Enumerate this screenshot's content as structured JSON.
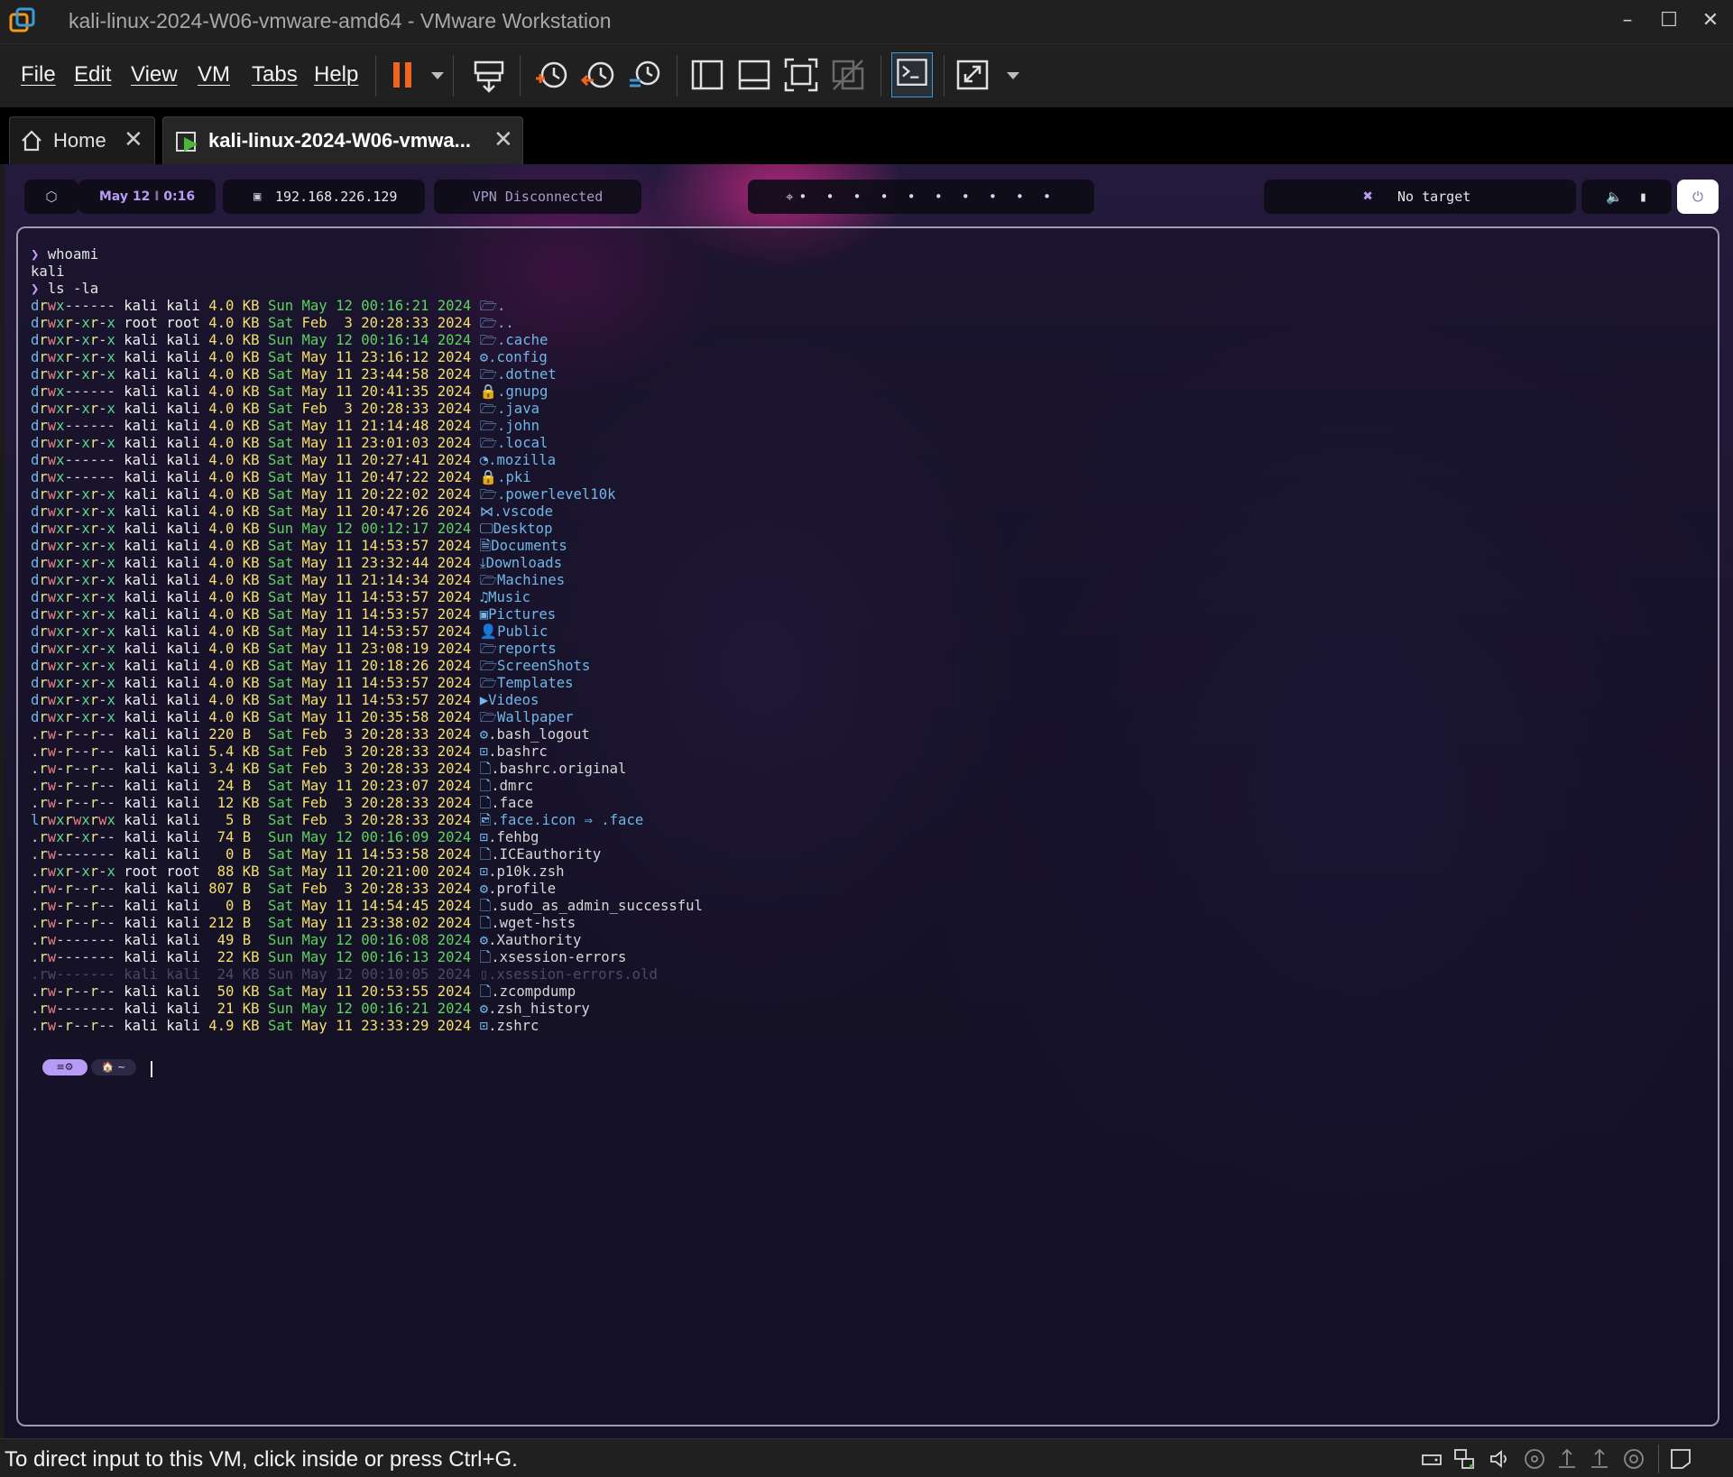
{
  "window": {
    "title": "kali-linux-2024-W06-vmware-amd64 - VMware Workstation"
  },
  "menu": [
    "File",
    "Edit",
    "View",
    "VM",
    "Tabs",
    "Help"
  ],
  "tabs": [
    {
      "label": "Home"
    },
    {
      "label": "kali-linux-2024-W06-vmwa..."
    }
  ],
  "toolbar_icons": [
    "pause-icon",
    "dropdown-icon",
    "send-ctrl-alt-del-icon",
    "take-snapshot-icon",
    "revert-snapshot-icon",
    "snapshot-manager-icon",
    "library-icon",
    "thumbnail-bar-icon",
    "full-screen-icon",
    "unity-icon",
    "console-view-icon",
    "stretch-guest-icon"
  ],
  "panel": {
    "date": "May 12",
    "time": "0:16",
    "ip": "192.168.226.129",
    "vpn": "VPN Disconnected",
    "target": "No target"
  },
  "terminal": {
    "commands": [
      {
        "prompt": "❯",
        "cmd": "whoami"
      },
      {
        "output": "kali"
      },
      {
        "prompt": "❯",
        "cmd": "ls -la"
      }
    ],
    "listing": [
      {
        "perm": "drwx------",
        "user": "kali",
        "group": "kali",
        "size": "4.0",
        "unit": "KB",
        "day": "Sun",
        "month": "May",
        "date": "12",
        "time": "00:16:21",
        "year": "2024",
        "icon": "🗁",
        "name": "."
      },
      {
        "perm": "drwxr-xr-x",
        "user": "root",
        "group": "root",
        "size": "4.0",
        "unit": "KB",
        "day": "Sat",
        "month": "Feb",
        "date": " 3",
        "time": "20:28:33",
        "year": "2024",
        "icon": "🗁",
        "name": ".."
      },
      {
        "perm": "drwxr-xr-x",
        "user": "kali",
        "group": "kali",
        "size": "4.0",
        "unit": "KB",
        "day": "Sun",
        "month": "May",
        "date": "12",
        "time": "00:16:14",
        "year": "2024",
        "icon": "🗁",
        "name": ".cache"
      },
      {
        "perm": "drwxr-xr-x",
        "user": "kali",
        "group": "kali",
        "size": "4.0",
        "unit": "KB",
        "day": "Sat",
        "month": "May",
        "date": "11",
        "time": "23:16:12",
        "year": "2024",
        "icon": "⚙",
        "name": ".config"
      },
      {
        "perm": "drwxr-xr-x",
        "user": "kali",
        "group": "kali",
        "size": "4.0",
        "unit": "KB",
        "day": "Sat",
        "month": "May",
        "date": "11",
        "time": "23:44:58",
        "year": "2024",
        "icon": "🗁",
        "name": ".dotnet"
      },
      {
        "perm": "drwx------",
        "user": "kali",
        "group": "kali",
        "size": "4.0",
        "unit": "KB",
        "day": "Sat",
        "month": "May",
        "date": "11",
        "time": "20:41:35",
        "year": "2024",
        "icon": "🔒",
        "name": ".gnupg"
      },
      {
        "perm": "drwxr-xr-x",
        "user": "kali",
        "group": "kali",
        "size": "4.0",
        "unit": "KB",
        "day": "Sat",
        "month": "Feb",
        "date": " 3",
        "time": "20:28:33",
        "year": "2024",
        "icon": "🗁",
        "name": ".java"
      },
      {
        "perm": "drwx------",
        "user": "kali",
        "group": "kali",
        "size": "4.0",
        "unit": "KB",
        "day": "Sat",
        "month": "May",
        "date": "11",
        "time": "21:14:48",
        "year": "2024",
        "icon": "🗁",
        "name": ".john"
      },
      {
        "perm": "drwxr-xr-x",
        "user": "kali",
        "group": "kali",
        "size": "4.0",
        "unit": "KB",
        "day": "Sat",
        "month": "May",
        "date": "11",
        "time": "23:01:03",
        "year": "2024",
        "icon": "🗁",
        "name": ".local"
      },
      {
        "perm": "drwx------",
        "user": "kali",
        "group": "kali",
        "size": "4.0",
        "unit": "KB",
        "day": "Sat",
        "month": "May",
        "date": "11",
        "time": "20:27:41",
        "year": "2024",
        "icon": "◔",
        "name": ".mozilla"
      },
      {
        "perm": "drwx------",
        "user": "kali",
        "group": "kali",
        "size": "4.0",
        "unit": "KB",
        "day": "Sat",
        "month": "May",
        "date": "11",
        "time": "20:47:22",
        "year": "2024",
        "icon": "🔒",
        "name": ".pki"
      },
      {
        "perm": "drwxr-xr-x",
        "user": "kali",
        "group": "kali",
        "size": "4.0",
        "unit": "KB",
        "day": "Sat",
        "month": "May",
        "date": "11",
        "time": "20:22:02",
        "year": "2024",
        "icon": "🗁",
        "name": ".powerlevel10k"
      },
      {
        "perm": "drwxr-xr-x",
        "user": "kali",
        "group": "kali",
        "size": "4.0",
        "unit": "KB",
        "day": "Sat",
        "month": "May",
        "date": "11",
        "time": "20:47:26",
        "year": "2024",
        "icon": "⋈",
        "name": ".vscode"
      },
      {
        "perm": "drwxr-xr-x",
        "user": "kali",
        "group": "kali",
        "size": "4.0",
        "unit": "KB",
        "day": "Sun",
        "month": "May",
        "date": "12",
        "time": "00:12:17",
        "year": "2024",
        "icon": "🖵",
        "name": "Desktop"
      },
      {
        "perm": "drwxr-xr-x",
        "user": "kali",
        "group": "kali",
        "size": "4.0",
        "unit": "KB",
        "day": "Sat",
        "month": "May",
        "date": "11",
        "time": "14:53:57",
        "year": "2024",
        "icon": "🗎",
        "name": "Documents"
      },
      {
        "perm": "drwxr-xr-x",
        "user": "kali",
        "group": "kali",
        "size": "4.0",
        "unit": "KB",
        "day": "Sat",
        "month": "May",
        "date": "11",
        "time": "23:32:44",
        "year": "2024",
        "icon": "⤓",
        "name": "Downloads"
      },
      {
        "perm": "drwxr-xr-x",
        "user": "kali",
        "group": "kali",
        "size": "4.0",
        "unit": "KB",
        "day": "Sat",
        "month": "May",
        "date": "11",
        "time": "21:14:34",
        "year": "2024",
        "icon": "🗁",
        "name": "Machines"
      },
      {
        "perm": "drwxr-xr-x",
        "user": "kali",
        "group": "kali",
        "size": "4.0",
        "unit": "KB",
        "day": "Sat",
        "month": "May",
        "date": "11",
        "time": "14:53:57",
        "year": "2024",
        "icon": "♫",
        "name": "Music"
      },
      {
        "perm": "drwxr-xr-x",
        "user": "kali",
        "group": "kali",
        "size": "4.0",
        "unit": "KB",
        "day": "Sat",
        "month": "May",
        "date": "11",
        "time": "14:53:57",
        "year": "2024",
        "icon": "▣",
        "name": "Pictures"
      },
      {
        "perm": "drwxr-xr-x",
        "user": "kali",
        "group": "kali",
        "size": "4.0",
        "unit": "KB",
        "day": "Sat",
        "month": "May",
        "date": "11",
        "time": "14:53:57",
        "year": "2024",
        "icon": "👤",
        "name": "Public"
      },
      {
        "perm": "drwxr-xr-x",
        "user": "kali",
        "group": "kali",
        "size": "4.0",
        "unit": "KB",
        "day": "Sat",
        "month": "May",
        "date": "11",
        "time": "23:08:19",
        "year": "2024",
        "icon": "🗁",
        "name": "reports"
      },
      {
        "perm": "drwxr-xr-x",
        "user": "kali",
        "group": "kali",
        "size": "4.0",
        "unit": "KB",
        "day": "Sat",
        "month": "May",
        "date": "11",
        "time": "20:18:26",
        "year": "2024",
        "icon": "🗁",
        "name": "ScreenShots"
      },
      {
        "perm": "drwxr-xr-x",
        "user": "kali",
        "group": "kali",
        "size": "4.0",
        "unit": "KB",
        "day": "Sat",
        "month": "May",
        "date": "11",
        "time": "14:53:57",
        "year": "2024",
        "icon": "🗁",
        "name": "Templates"
      },
      {
        "perm": "drwxr-xr-x",
        "user": "kali",
        "group": "kali",
        "size": "4.0",
        "unit": "KB",
        "day": "Sat",
        "month": "May",
        "date": "11",
        "time": "14:53:57",
        "year": "2024",
        "icon": "▶",
        "name": "Videos"
      },
      {
        "perm": "drwxr-xr-x",
        "user": "kali",
        "group": "kali",
        "size": "4.0",
        "unit": "KB",
        "day": "Sat",
        "month": "May",
        "date": "11",
        "time": "20:35:58",
        "year": "2024",
        "icon": "🗁",
        "name": "Wallpaper"
      },
      {
        "perm": ".rw-r--r--",
        "user": "kali",
        "group": "kali",
        "size": "220",
        "unit": "B ",
        "day": "Sat",
        "month": "Feb",
        "date": " 3",
        "time": "20:28:33",
        "year": "2024",
        "icon": "⚙",
        "name": ".bash_logout"
      },
      {
        "perm": ".rw-r--r--",
        "user": "kali",
        "group": "kali",
        "size": "5.4",
        "unit": "KB",
        "day": "Sat",
        "month": "Feb",
        "date": " 3",
        "time": "20:28:33",
        "year": "2024",
        "icon": "⊡",
        "name": ".bashrc"
      },
      {
        "perm": ".rw-r--r--",
        "user": "kali",
        "group": "kali",
        "size": "3.4",
        "unit": "KB",
        "day": "Sat",
        "month": "Feb",
        "date": " 3",
        "time": "20:28:33",
        "year": "2024",
        "icon": "🗋",
        "name": ".bashrc.original"
      },
      {
        "perm": ".rw-r--r--",
        "user": "kali",
        "group": "kali",
        "size": " 24",
        "unit": "B ",
        "day": "Sat",
        "month": "May",
        "date": "11",
        "time": "20:23:07",
        "year": "2024",
        "icon": "🗋",
        "name": ".dmrc"
      },
      {
        "perm": ".rw-r--r--",
        "user": "kali",
        "group": "kali",
        "size": " 12",
        "unit": "KB",
        "day": "Sat",
        "month": "Feb",
        "date": " 3",
        "time": "20:28:33",
        "year": "2024",
        "icon": "🗋",
        "name": ".face"
      },
      {
        "perm": "lrwxrwxrwx",
        "user": "kali",
        "group": "kali",
        "size": "  5",
        "unit": "B ",
        "day": "Sat",
        "month": "Feb",
        "date": " 3",
        "time": "20:28:33",
        "year": "2024",
        "icon": "🖻",
        "name": ".face.icon ⇒ .face"
      },
      {
        "perm": ".rwxr-xr--",
        "user": "kali",
        "group": "kali",
        "size": " 74",
        "unit": "B ",
        "day": "Sun",
        "month": "May",
        "date": "12",
        "time": "00:16:09",
        "year": "2024",
        "icon": "⊡",
        "name": ".fehbg"
      },
      {
        "perm": ".rw-------",
        "user": "kali",
        "group": "kali",
        "size": "  0",
        "unit": "B ",
        "day": "Sat",
        "month": "May",
        "date": "11",
        "time": "14:53:58",
        "year": "2024",
        "icon": "🗋",
        "name": ".ICEauthority"
      },
      {
        "perm": ".rwxr-xr-x",
        "user": "root",
        "group": "root",
        "size": " 88",
        "unit": "KB",
        "day": "Sat",
        "month": "May",
        "date": "11",
        "time": "20:21:00",
        "year": "2024",
        "icon": "⊡",
        "name": ".p10k.zsh"
      },
      {
        "perm": ".rw-r--r--",
        "user": "kali",
        "group": "kali",
        "size": "807",
        "unit": "B ",
        "day": "Sat",
        "month": "Feb",
        "date": " 3",
        "time": "20:28:33",
        "year": "2024",
        "icon": "⚙",
        "name": ".profile"
      },
      {
        "perm": ".rw-r--r--",
        "user": "kali",
        "group": "kali",
        "size": "  0",
        "unit": "B ",
        "day": "Sat",
        "month": "May",
        "date": "11",
        "time": "14:54:45",
        "year": "2024",
        "icon": "🗋",
        "name": ".sudo_as_admin_successful"
      },
      {
        "perm": ".rw-r--r--",
        "user": "kali",
        "group": "kali",
        "size": "212",
        "unit": "B ",
        "day": "Sat",
        "month": "May",
        "date": "11",
        "time": "23:38:02",
        "year": "2024",
        "icon": "🗋",
        "name": ".wget-hsts"
      },
      {
        "perm": ".rw-------",
        "user": "kali",
        "group": "kali",
        "size": " 49",
        "unit": "B ",
        "day": "Sun",
        "month": "May",
        "date": "12",
        "time": "00:16:08",
        "year": "2024",
        "icon": "⚙",
        "name": ".Xauthority"
      },
      {
        "perm": ".rw-------",
        "user": "kali",
        "group": "kali",
        "size": " 22",
        "unit": "KB",
        "day": "Sun",
        "month": "May",
        "date": "12",
        "time": "00:16:13",
        "year": "2024",
        "icon": "🗋",
        "name": ".xsession-errors"
      },
      {
        "perm": ".rw-------",
        "user": "kali",
        "group": "kali",
        "size": " 24",
        "unit": "KB",
        "day": "Sun",
        "month": "May",
        "date": "12",
        "time": "00:10:05",
        "year": "2024",
        "icon": "▯",
        "name": ".xsession-errors.old",
        "dim": true
      },
      {
        "perm": ".rw-r--r--",
        "user": "kali",
        "group": "kali",
        "size": " 50",
        "unit": "KB",
        "day": "Sat",
        "month": "May",
        "date": "11",
        "time": "20:53:55",
        "year": "2024",
        "icon": "🗋",
        "name": ".zcompdump"
      },
      {
        "perm": ".rw-------",
        "user": "kali",
        "group": "kali",
        "size": " 21",
        "unit": "KB",
        "day": "Sun",
        "month": "May",
        "date": "12",
        "time": "00:16:21",
        "year": "2024",
        "icon": "⚙",
        "name": ".zsh_history"
      },
      {
        "perm": ".rw-r--r--",
        "user": "kali",
        "group": "kali",
        "size": "4.9",
        "unit": "KB",
        "day": "Sat",
        "month": "May",
        "date": "11",
        "time": "23:33:29",
        "year": "2024",
        "icon": "⊡",
        "name": ".zshrc"
      }
    ],
    "prompt_dir": "~"
  },
  "status": {
    "message": "To direct input to this VM, click inside or press Ctrl+G."
  },
  "colors": {
    "accent": "#d4531a",
    "purple": "#b69cf5",
    "dir_blue": "#6fb7e6"
  }
}
